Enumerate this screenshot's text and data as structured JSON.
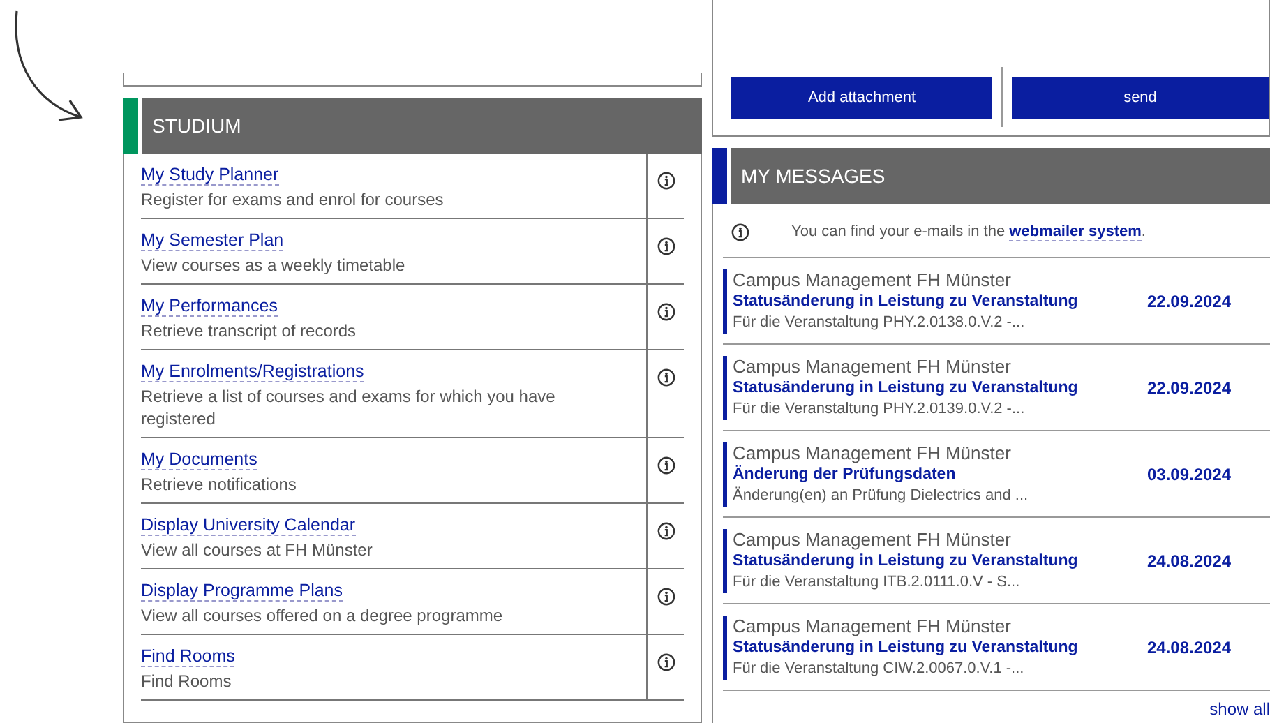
{
  "studium": {
    "title": "STUDIUM",
    "items": [
      {
        "link": "My Study Planner",
        "description": "Register for exams and enrol for courses"
      },
      {
        "link": "My Semester Plan",
        "description": "View courses as a weekly timetable"
      },
      {
        "link": "My Performances",
        "description": "Retrieve transcript of records"
      },
      {
        "link": "My Enrolments/Registrations",
        "description": "Retrieve a list of courses and exams for which you have registered"
      },
      {
        "link": "My Documents",
        "description": "Retrieve notifications"
      },
      {
        "link": "Display University Calendar",
        "description": "View all courses at FH Münster"
      },
      {
        "link": "Display Programme Plans",
        "description": "View all courses offered on a degree programme"
      },
      {
        "link": "Find Rooms",
        "description": "Find Rooms"
      }
    ]
  },
  "compose": {
    "buttons": [
      "Add attachment",
      "send"
    ]
  },
  "messages": {
    "title": "MY MESSAGES",
    "notice": "You can find your e-mails in the ",
    "notice_link": "webmailer system",
    "notice_end": ".",
    "items": [
      {
        "sender": "Campus Management FH Münster",
        "subject": "Statusänderung in Leistung zu Veranstaltung",
        "preview": "Für die Veranstaltung PHY.2.0138.0.V.2 -...",
        "date": "22.09.2024"
      },
      {
        "sender": "Campus Management FH Münster",
        "subject": "Statusänderung in Leistung zu Veranstaltung",
        "preview": "Für die Veranstaltung PHY.2.0139.0.V.2 -...",
        "date": "22.09.2024"
      },
      {
        "sender": "Campus Management FH Münster",
        "subject": "Änderung der Prüfungsdaten",
        "preview": "Änderung(en) an Prüfung Dielectrics and ...",
        "date": "03.09.2024"
      },
      {
        "sender": "Campus Management FH Münster",
        "subject": "Statusänderung in Leistung zu Veranstaltung",
        "preview": "Für die Veranstaltung ITB.2.0111.0.V - S...",
        "date": "24.08.2024"
      },
      {
        "sender": "Campus Management FH Münster",
        "subject": "Statusänderung in Leistung zu Veranstaltung",
        "preview": "Für die Veranstaltung CIW.2.0067.0.V.1 -...",
        "date": "24.08.2024"
      }
    ],
    "show_all": "show all"
  }
}
